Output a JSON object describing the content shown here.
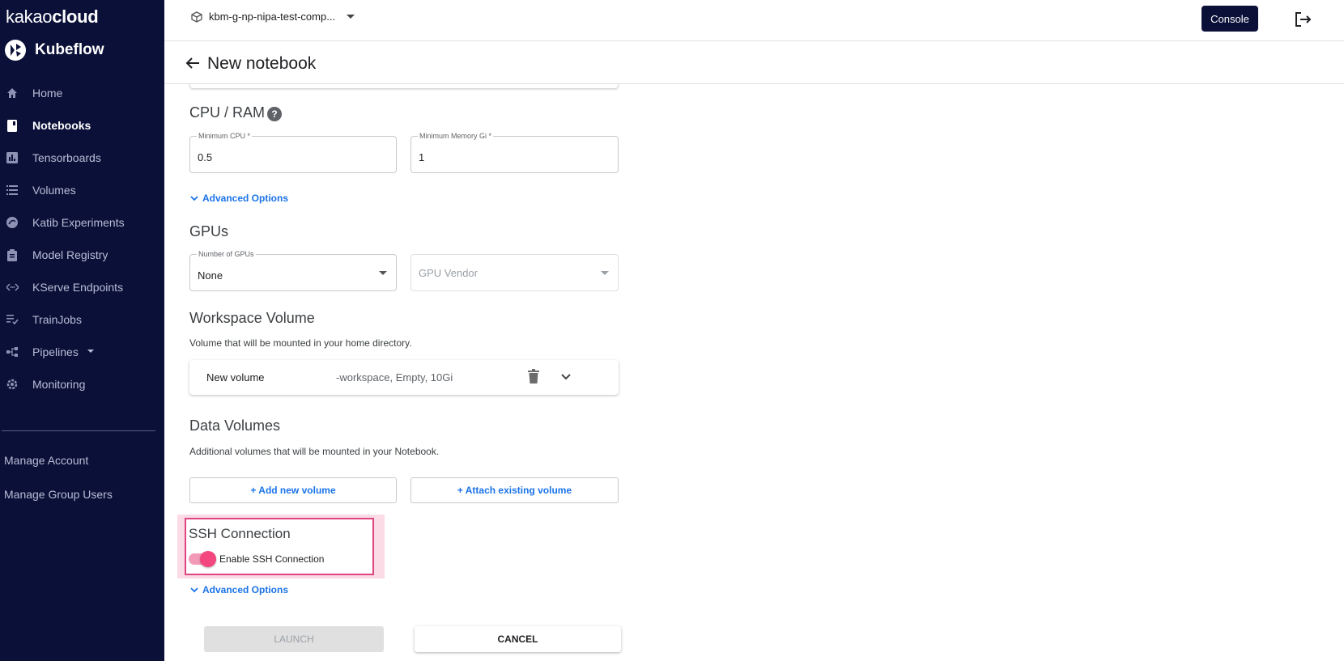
{
  "brand": {
    "part1": "kakao",
    "part2": "cloud",
    "product": "Kubeflow"
  },
  "sidebar": {
    "items": [
      {
        "label": "Home",
        "icon": "home-icon"
      },
      {
        "label": "Notebooks",
        "icon": "notebook-icon",
        "active": true
      },
      {
        "label": "Tensorboards",
        "icon": "tensorboard-icon"
      },
      {
        "label": "Volumes",
        "icon": "volumes-icon"
      },
      {
        "label": "Katib Experiments",
        "icon": "katib-icon"
      },
      {
        "label": "Model Registry",
        "icon": "clipboard-icon"
      },
      {
        "label": "KServe Endpoints",
        "icon": "endpoints-icon"
      },
      {
        "label": "TrainJobs",
        "icon": "checklist-icon"
      },
      {
        "label": "Pipelines",
        "icon": "pipelines-icon"
      },
      {
        "label": "Monitoring",
        "icon": "gear-icon"
      }
    ],
    "links": [
      "Manage Account",
      "Manage Group Users"
    ]
  },
  "topbar": {
    "namespace": "kbm-g-np-nipa-test-comp...",
    "console_label": "Console"
  },
  "page": {
    "title": "New notebook"
  },
  "cpu_ram": {
    "heading": "CPU / RAM",
    "help": "?",
    "cpu": {
      "label": "Minimum CPU *",
      "value": "0.5"
    },
    "memory": {
      "label": "Minimum Memory Gi *",
      "value": "1"
    },
    "advanced": "Advanced Options"
  },
  "gpus": {
    "heading": "GPUs",
    "number": {
      "label": "Number of GPUs",
      "value": "None"
    },
    "vendor": {
      "placeholder": "GPU Vendor"
    }
  },
  "workspace": {
    "heading": "Workspace Volume",
    "description": "Volume that will be mounted in your home directory.",
    "volume_name": "New volume",
    "volume_info": "-workspace, Empty, 10Gi"
  },
  "data_volumes": {
    "heading": "Data Volumes",
    "description": "Additional volumes that will be mounted in your Notebook.",
    "add_label": "+ Add new volume",
    "attach_label": "+ Attach existing volume"
  },
  "ssh": {
    "heading": "SSH Connection",
    "toggle_label": "Enable SSH Connection",
    "enabled": true
  },
  "advanced2": "Advanced Options",
  "actions": {
    "launch": "LAUNCH",
    "cancel": "CANCEL"
  },
  "colors": {
    "sidebar": "#0b1038",
    "accent": "#1a73e8",
    "toggle": "#f4467f",
    "highlight": "#e0447f"
  }
}
